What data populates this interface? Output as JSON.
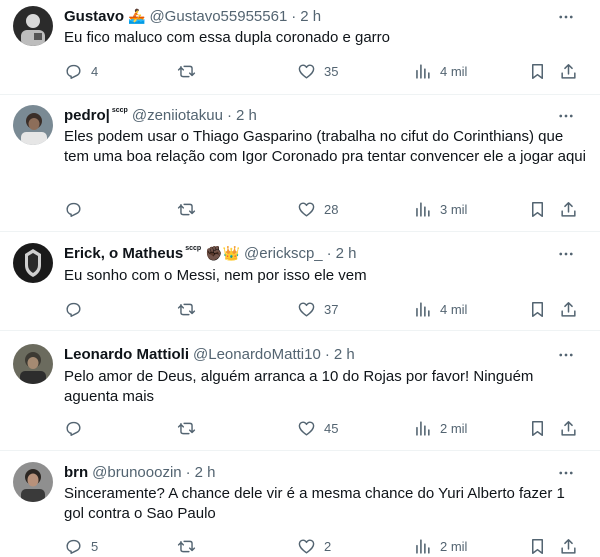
{
  "tweets": [
    {
      "name": "Gustavo",
      "badge": "",
      "emoji": "🚣",
      "handle": "@Gustavo55955561",
      "time": "2 h",
      "text": "Eu fico maluco com essa dupla coronado e garro",
      "replies": "4",
      "retweets": "",
      "likes": "35",
      "views": "4 mil"
    },
    {
      "name": "pedro|",
      "badge": "sccp",
      "emoji": "",
      "handle": "@zeniiotakuu",
      "time": "2 h",
      "text": "Eles podem usar o Thiago Gasparino (trabalha no cifut do Corinthians) que tem uma boa relação com Igor Coronado pra tentar convencer ele a jogar aqui",
      "replies": "",
      "retweets": "",
      "likes": "28",
      "views": "3 mil"
    },
    {
      "name": "Erick, o Matheus",
      "badge": "sccp",
      "emoji": "✊🏿👑",
      "handle": "@erickscp_",
      "time": "2 h",
      "text": "Eu sonho com o Messi, nem por isso ele vem",
      "replies": "",
      "retweets": "",
      "likes": "37",
      "views": "4 mil"
    },
    {
      "name": "Leonardo Mattioli",
      "badge": "",
      "emoji": "",
      "handle": "@LeonardoMatti10",
      "time": "2 h",
      "text": "Pelo amor de Deus, alguém arranca a 10 do Rojas por favor! Ninguém aguenta mais",
      "replies": "",
      "retweets": "",
      "likes": "45",
      "views": "2 mil"
    },
    {
      "name": "brn",
      "badge": "",
      "emoji": "",
      "handle": "@brunooozin",
      "time": "2 h",
      "text": "Sinceramente? A chance dele vir é a mesma chance do Yuri Alberto fazer 1 gol contra o Sao Paulo",
      "replies": "5",
      "retweets": "",
      "likes": "2",
      "views": "2 mil"
    }
  ],
  "separator": "·",
  "icons": {
    "reply": "reply-icon",
    "retweet": "retweet-icon",
    "like": "heart-icon",
    "views": "views-bar-chart-icon",
    "bookmark": "bookmark-icon",
    "share": "share-icon",
    "more": "more-dots-icon"
  },
  "colors": {
    "text": "#0f1419",
    "secondary": "#536471",
    "divider": "#eff3f4"
  }
}
